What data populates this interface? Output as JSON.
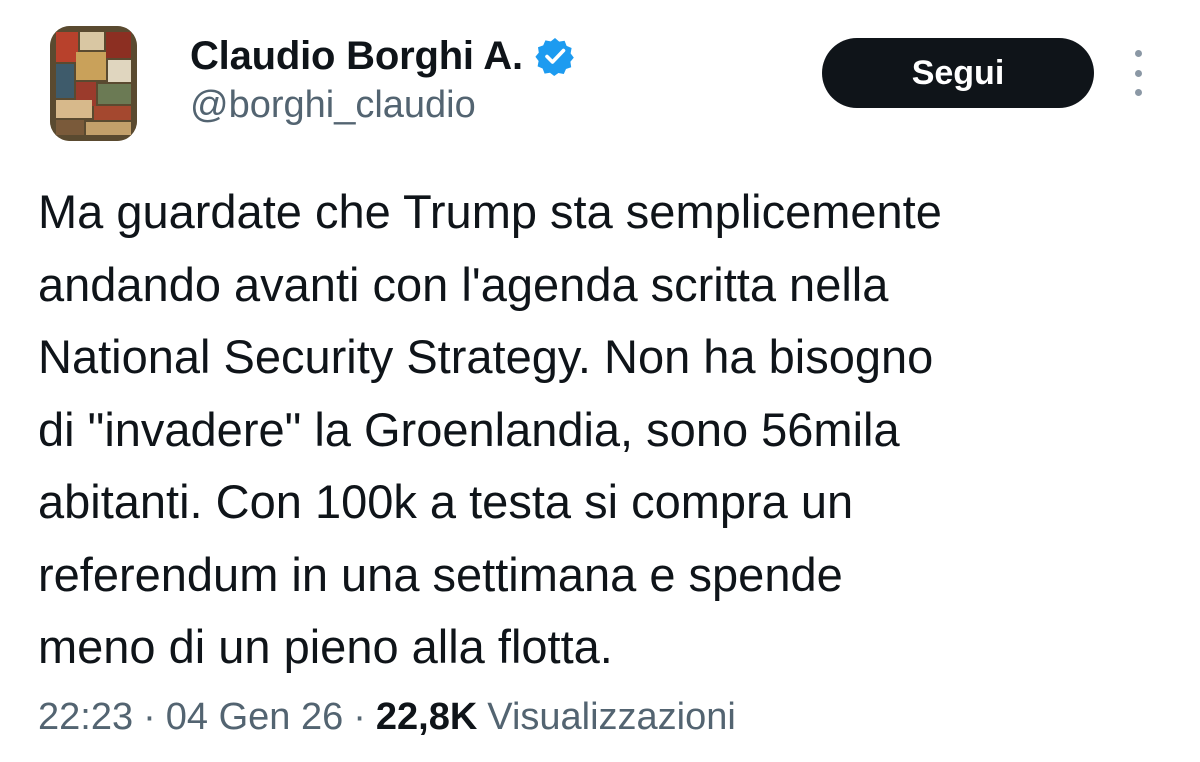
{
  "author": {
    "display_name": "Claudio Borghi A.",
    "handle": "@borghi_claudio",
    "verified_icon": "verified-badge-icon",
    "avatar_icon": "abstract-painting-avatar"
  },
  "actions": {
    "follow_label": "Segui",
    "more_icon": "vertical-ellipsis-icon"
  },
  "tweet": {
    "lines": [
      "Ma guardate che Trump sta semplicemente",
      "andando avanti con l'agenda scritta nella",
      "National Security Strategy. Non ha bisogno",
      "di \"invadere\" la Groenlandia, sono 56mila",
      "abitanti. Con 100k a testa si compra un",
      "referendum in una settimana e spende",
      "meno di un pieno alla flotta."
    ]
  },
  "meta": {
    "time": "22:23",
    "separator": "·",
    "date": "04 Gen 26",
    "views_count": "22,8K",
    "views_label": "Visualizzazioni"
  },
  "colors": {
    "text_primary": "#0f1419",
    "text_secondary": "#536471",
    "verified_blue": "#1d9bf0",
    "button_bg": "#0f1419",
    "button_text": "#ffffff"
  }
}
